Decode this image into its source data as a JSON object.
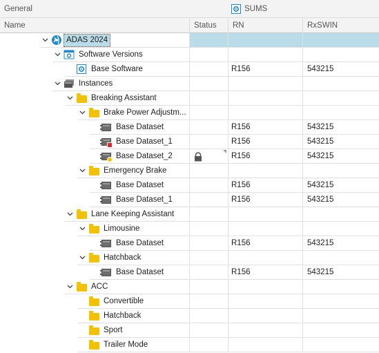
{
  "group_header": {
    "general": "General",
    "sums": "SUMS"
  },
  "columns": {
    "name": "Name",
    "status": "Status",
    "rn": "RN",
    "rxswin": "RxSWIN"
  },
  "rows": [
    {
      "label": "ADAS 2024",
      "rn": "",
      "rx": ""
    },
    {
      "label": "Software Versions",
      "rn": "",
      "rx": ""
    },
    {
      "label": "Base Software",
      "rn": "R156",
      "rx": "543215"
    },
    {
      "label": "Instances",
      "rn": "",
      "rx": ""
    },
    {
      "label": "Breaking Assistant",
      "rn": "",
      "rx": ""
    },
    {
      "label": "Brake Power Adjustm...",
      "rn": "",
      "rx": ""
    },
    {
      "label": "Base Dataset",
      "rn": "R156",
      "rx": "543215"
    },
    {
      "label": "Base Dataset_1",
      "rn": "R156",
      "rx": "543215"
    },
    {
      "label": "Base Dataset_2",
      "rn": "R156",
      "rx": "543215"
    },
    {
      "label": "Emergency Brake",
      "rn": "",
      "rx": ""
    },
    {
      "label": "Base Dataset",
      "rn": "R156",
      "rx": "543215"
    },
    {
      "label": "Base Dataset_1",
      "rn": "R156",
      "rx": "543215"
    },
    {
      "label": "Lane Keeping Assistant",
      "rn": "",
      "rx": ""
    },
    {
      "label": "Limousine",
      "rn": "",
      "rx": ""
    },
    {
      "label": "Base Dataset",
      "rn": "R156",
      "rx": "543215"
    },
    {
      "label": "Hatchback",
      "rn": "",
      "rx": ""
    },
    {
      "label": "Base Dataset",
      "rn": "R156",
      "rx": "543215"
    },
    {
      "label": "ACC",
      "rn": "",
      "rx": ""
    },
    {
      "label": "Convertible",
      "rn": "",
      "rx": ""
    },
    {
      "label": "Hatchback",
      "rn": "",
      "rx": ""
    },
    {
      "label": "Sport",
      "rn": "",
      "rx": ""
    },
    {
      "label": "Trailer Mode",
      "rn": "",
      "rx": ""
    }
  ],
  "colors": {
    "selection": "#b9dce8",
    "folder": "#f2c200",
    "accent": "#1e88c8"
  },
  "icons": {
    "sums": "gear-box-icon",
    "project": "globe-icon",
    "software_versions": "window-gear-icon",
    "software": "gear-box-icon",
    "instances": "dataset-stack-icon",
    "folder": "folder-icon",
    "dataset": "dataset-icon",
    "status_lock": "lock-icon"
  }
}
